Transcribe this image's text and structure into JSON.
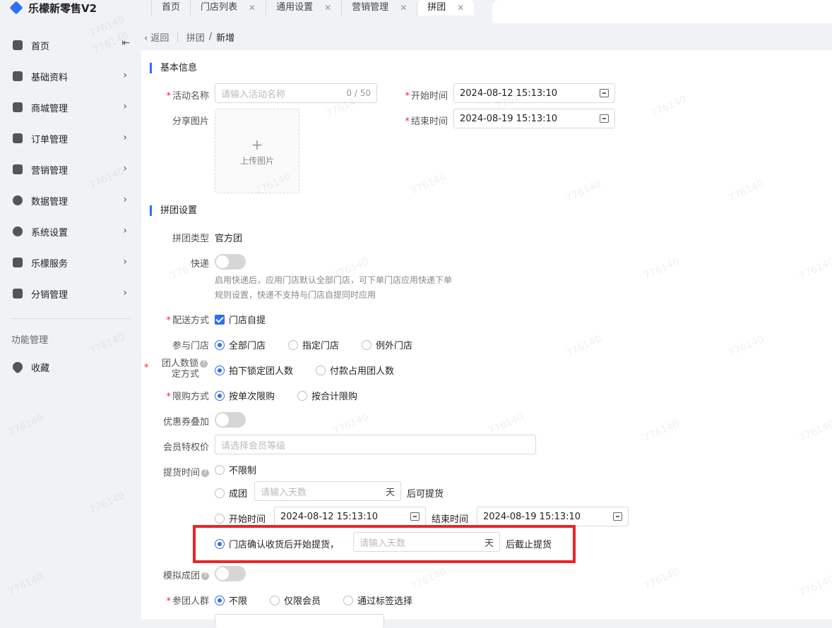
{
  "app": {
    "title": "乐檬新零售V2"
  },
  "tabs": [
    {
      "label": "首页",
      "closable": false,
      "active": false
    },
    {
      "label": "门店列表",
      "closable": true,
      "active": false
    },
    {
      "label": "通用设置",
      "closable": true,
      "active": false
    },
    {
      "label": "营销管理",
      "closable": true,
      "active": false
    },
    {
      "label": "拼团",
      "closable": true,
      "active": true
    }
  ],
  "sidebar": {
    "items": [
      {
        "label": "首页",
        "icon": "home-icon"
      },
      {
        "label": "基础资料",
        "icon": "cube-icon"
      },
      {
        "label": "商城管理",
        "icon": "shop-icon"
      },
      {
        "label": "订单管理",
        "icon": "order-icon"
      },
      {
        "label": "营销管理",
        "icon": "marketing-icon"
      },
      {
        "label": "数据管理",
        "icon": "pie-chart-icon"
      },
      {
        "label": "系统设置",
        "icon": "settings-icon"
      },
      {
        "label": "乐檬服务",
        "icon": "briefcase-icon"
      },
      {
        "label": "分销管理",
        "icon": "cube-icon"
      }
    ],
    "section_label": "功能管理",
    "favorites_label": "收藏"
  },
  "breadcrumb": {
    "back": "返回",
    "parent": "拼团",
    "separator": "/",
    "current": "新增"
  },
  "basic": {
    "title": "基本信息",
    "name_label": "活动名称",
    "name_placeholder": "请输入活动名称",
    "name_counter": "0 / 50",
    "share_label": "分享图片",
    "upload_label": "上传图片",
    "upload_plus": "+",
    "start_label": "开始时间",
    "start_value": "2024-08-12 15:13:10",
    "end_label": "结束时间",
    "end_value": "2024-08-19 15:13:10"
  },
  "group": {
    "title": "拼团设置",
    "type_label": "拼团类型",
    "type_value": "官方团",
    "express_label": "快递",
    "express_hint_1": "启用快递后，应用门店默认全部门店，可下单门店应用快递下单",
    "express_hint_2": "规则设置，快递不支持与门店自提同时应用",
    "delivery_label": "配送方式",
    "delivery_option": "门店自提",
    "store_label": "参与门店",
    "store_options": [
      "全部门店",
      "指定门店",
      "例外门店"
    ],
    "lock_label_1": "团人数锁",
    "lock_label_2": "定方式",
    "lock_options": [
      "拍下锁定团人数",
      "付款占用团人数"
    ],
    "limit_label": "限购方式",
    "limit_options": [
      "按单次限购",
      "按合计限购"
    ],
    "coupon_label": "优惠券叠加",
    "member_price_label": "会员特权价",
    "member_price_placeholder": "请选择会员等级",
    "pickup_label": "提货时间",
    "pickup_opt_unlimited": "不限制",
    "pickup_opt_group": "成团",
    "pickup_days_placeholder": "请输入天数",
    "pickup_days_unit": "天",
    "pickup_after_text": "后可提货",
    "pickup_opt_start": "开始时间",
    "pickup_start_value": "2024-08-12 15:13:10",
    "pickup_end_label": "结束时间",
    "pickup_end_value": "2024-08-19 15:13:10",
    "pickup_opt_confirm": "门店确认收货后开始提货，",
    "pickup_confirm_placeholder": "请输入天数",
    "pickup_confirm_unit": "天",
    "pickup_confirm_after": "后截止提货",
    "simulate_label": "模拟成团",
    "crowd_label": "参团人群",
    "crowd_options": [
      "不限",
      "仅限会员",
      "通过标签选择"
    ]
  },
  "watermark_text": "776140",
  "colors": {
    "accent": "#2f6ff0",
    "required": "#f5222d",
    "highlight": "#e8262a"
  }
}
